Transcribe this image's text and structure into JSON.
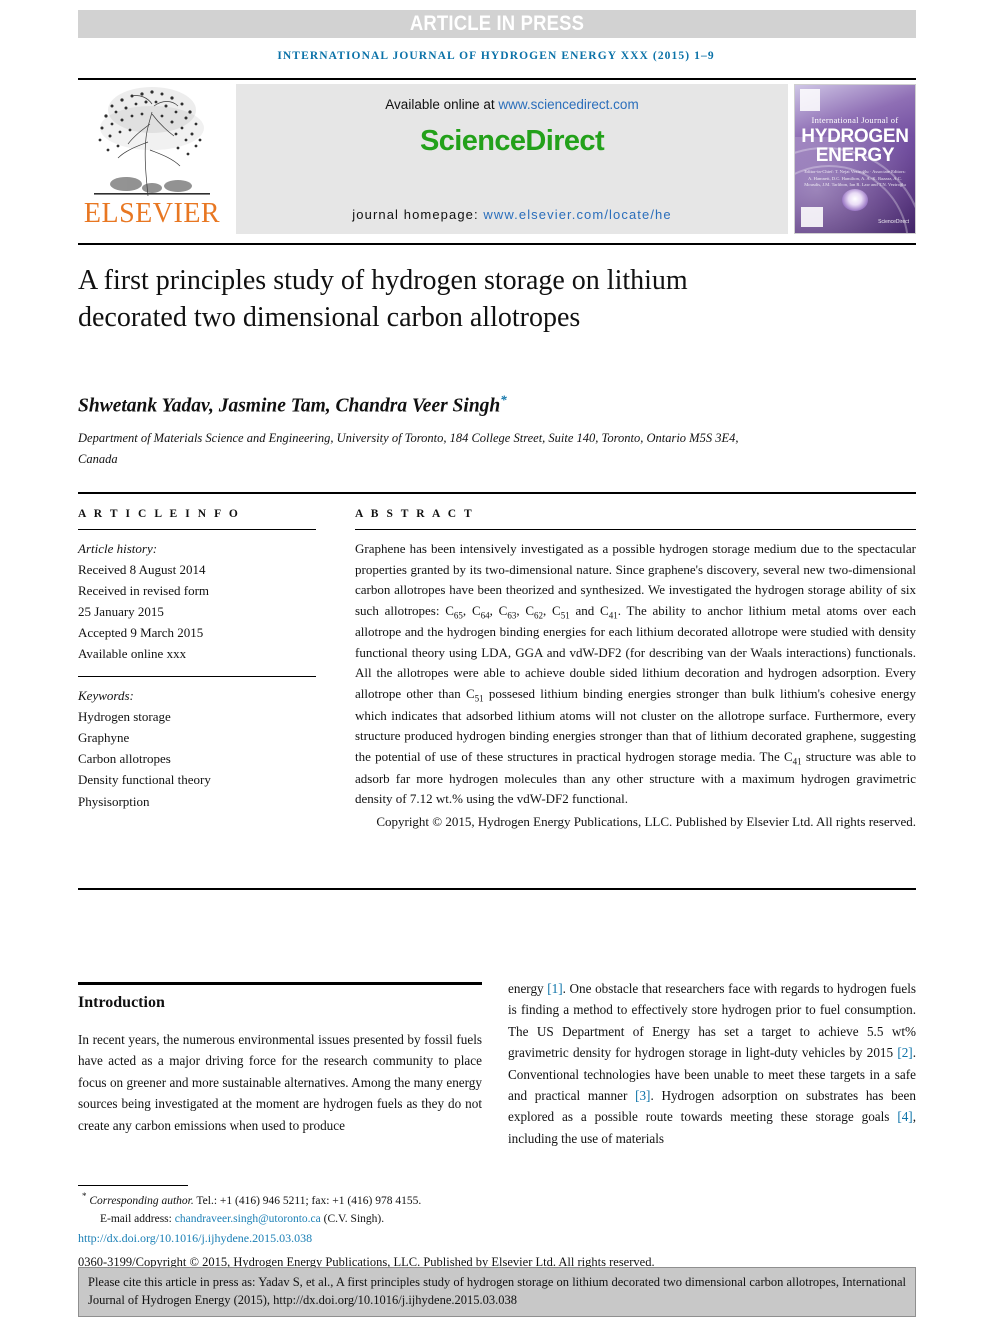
{
  "banner": {
    "label": "ARTICLE IN PRESS"
  },
  "running_head": "INTERNATIONAL JOURNAL OF HYDROGEN ENERGY XXX (2015) 1–9",
  "masthead": {
    "elsevier_wordmark": "ELSEVIER",
    "available_prefix": "Available online at ",
    "available_url": "www.sciencedirect.com",
    "sciencedirect_logo": "ScienceDirect",
    "homepage_prefix": "journal homepage: ",
    "homepage_url": "www.elsevier.com/locate/he",
    "cover": {
      "line1": "International Journal of",
      "line2": "HYDROGEN",
      "line3": "ENERGY",
      "editors": "Editor-in-Chief: T. Nejat Veziroğlu  ·  Associate Editors: A. Hamnett, D.C. Hamilton, A. A.-K. Bazzaz, A.C. Mousdis, J.M. Tarlibon, Ian R. Law and T.N. Veziroğlu",
      "sciencedirect": "ScienceDirect"
    }
  },
  "article": {
    "title": "A first principles study of hydrogen storage on lithium decorated two dimensional carbon allotropes",
    "authors": "Shwetank Yadav, Jasmine Tam, Chandra Veer Singh",
    "author_marker": "*",
    "affiliation": "Department of Materials Science and Engineering, University of Toronto, 184 College Street, Suite 140, Toronto, Ontario M5S 3E4, Canada"
  },
  "info": {
    "heading": "A R T I C L E   I N F O",
    "history_label": "Article history:",
    "history": [
      "Received 8 August 2014",
      "Received in revised form",
      "25 January 2015",
      "Accepted 9 March 2015",
      "Available online xxx"
    ],
    "keywords_label": "Keywords:",
    "keywords": [
      "Hydrogen storage",
      "Graphyne",
      "Carbon allotropes",
      "Density functional theory",
      "Physisorption"
    ]
  },
  "abstract": {
    "heading": "A B S T R A C T",
    "p1_a": "Graphene has been intensively investigated as a possible hydrogen storage medium due to the spectacular properties granted by its two-dimensional nature. Since graphene's discovery, several new two-dimensional carbon allotropes have been theorized and synthesized. We investigated the hydrogen storage ability of six such allotropes: C",
    "sub1": "65",
    "mid1": ", C",
    "sub2": "64",
    "mid2": ", C",
    "sub3": "63",
    "mid3": ", C",
    "sub4": "62",
    "mid4": ", C",
    "sub5": "51",
    "mid5": " and C",
    "sub6": "41",
    "p1_b": ". The ability to anchor lithium metal atoms over each allotrope and the hydrogen binding energies for each lithium decorated allotrope were studied with density functional theory using LDA, GGA and vdW-DF2 (for describing van der Waals interactions) functionals. All the allotropes were able to achieve double sided lithium decoration and hydrogen adsorption. Every allotrope other than C",
    "sub7": "51",
    "p1_c": " possesed lithium binding energies stronger than bulk lithium's cohesive energy which indicates that adsorbed lithium atoms will not cluster on the allotrope surface. Furthermore, every structure produced hydrogen binding energies stronger than that of lithium decorated graphene, suggesting the potential of use of these structures in practical hydrogen storage media. The C",
    "sub8": "41",
    "p1_d": " structure was able to adsorb far more hydrogen molecules than any other structure with a maximum hydrogen gravimetric density of 7.12 wt.% using the vdW-DF2 functional.",
    "copyright": "Copyright © 2015, Hydrogen Energy Publications, LLC. Published by Elsevier Ltd. All rights reserved."
  },
  "introduction": {
    "heading": "Introduction",
    "left_text": "In recent years, the numerous environmental issues presented by fossil fuels have acted as a major driving force for the research community to place focus on greener and more sustainable alternatives. Among the many energy sources being investigated at the moment are hydrogen fuels as they do not create any carbon emissions when used to produce",
    "right_a": "energy ",
    "ref1": "[1]",
    "right_b": ". One obstacle that researchers face with regards to hydrogen fuels is finding a method to effectively store hydrogen prior to fuel consumption. The US Department of Energy has set a target to achieve 5.5 wt% gravimetric density for hydrogen storage in light-duty vehicles by 2015 ",
    "ref2": "[2]",
    "right_c": ". Conventional technologies have been unable to meet these targets in a safe and practical manner ",
    "ref3": "[3]",
    "right_d": ". Hydrogen adsorption on substrates has been explored as a possible route towards meeting these storage goals ",
    "ref4": "[4]",
    "right_e": ", including the use of materials"
  },
  "footnotes": {
    "corresponding_marker": "*",
    "corresponding_label": "Corresponding author.",
    "corresponding_rest": " Tel.: +1 (416) 946 5211; fax: +1 (416) 978 4155.",
    "email_label": "E-mail address: ",
    "email": "chandraveer.singh@utoronto.ca",
    "email_suffix": " (C.V. Singh).",
    "doi": "http://dx.doi.org/10.1016/j.ijhydene.2015.03.038",
    "issn_line": "0360-3199/Copyright © 2015, Hydrogen Energy Publications, LLC. Published by Elsevier Ltd. All rights reserved."
  },
  "citation_box": {
    "text": "Please cite this article in press as: Yadav S, et al., A first principles study of hydrogen storage on lithium decorated two dimensional carbon allotropes, International Journal of Hydrogen Energy (2015), http://dx.doi.org/10.1016/j.ijhydene.2015.03.038"
  },
  "colors": {
    "link_blue": "#2a6ebb",
    "headline_blue": "#0b72a8",
    "sciencedirect_green": "#23a11a",
    "elsevier_orange": "#e87722",
    "banner_grey": "#d2d2d2",
    "cite_box_grey": "#c8c8c8"
  }
}
